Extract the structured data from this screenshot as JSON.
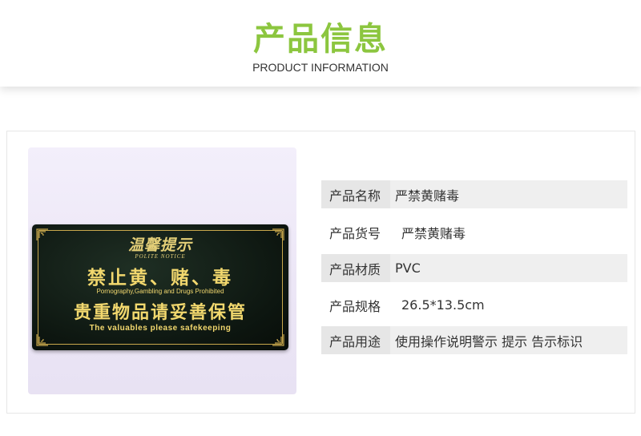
{
  "header": {
    "title": "产品信息",
    "subtitle": "PRODUCT INFORMATION",
    "accent_color": "#8cc63f"
  },
  "product_image": {
    "sign": {
      "heading": "温馨提示",
      "heading_en": "POLITE NOTICE",
      "line1": "禁止黄、赌、毒",
      "line1_en": "Pornography,Gambling and Drugs Prohibited",
      "line2": "贵重物品请妥善保管",
      "line2_en": "The valuables please safekeeping",
      "text_color": "#f2d86e",
      "background_color": "#0d1610"
    }
  },
  "specs": [
    {
      "label": "产品名称",
      "value": "严禁黄赌毒",
      "shaded": true
    },
    {
      "label": "产品货号",
      "value": "严禁黄赌毒",
      "shaded": false
    },
    {
      "label": "产品材质",
      "value": "PVC",
      "shaded": true
    },
    {
      "label": "产品规格",
      "value": "26.5*13.5cm",
      "shaded": false
    },
    {
      "label": "产品用途",
      "value": "使用操作说明警示 提示 告示标识",
      "shaded": true
    }
  ]
}
